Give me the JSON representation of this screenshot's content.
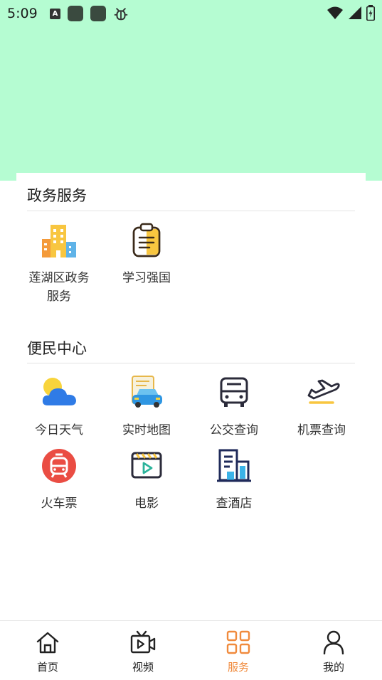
{
  "status_bar": {
    "time": "5:09",
    "a_badge": "A",
    "icons": [
      "a-badge-icon",
      "app-square-icon",
      "app-square-icon",
      "bug-icon",
      "wifi-icon",
      "signal-icon",
      "battery-icon"
    ]
  },
  "sections": [
    {
      "title": "政务服务",
      "items": [
        {
          "label": "莲湖区政务服务",
          "icon": "buildings-icon"
        },
        {
          "label": "学习强国",
          "icon": "clipboard-icon"
        }
      ]
    },
    {
      "title": "便民中心",
      "items": [
        {
          "label": "今日天气",
          "icon": "weather-icon"
        },
        {
          "label": "实时地图",
          "icon": "car-map-icon"
        },
        {
          "label": "公交查询",
          "icon": "bus-icon"
        },
        {
          "label": "机票查询",
          "icon": "airplane-icon"
        },
        {
          "label": "火车票",
          "icon": "train-icon"
        },
        {
          "label": "电影",
          "icon": "movie-icon"
        },
        {
          "label": "查酒店",
          "icon": "hotel-icon"
        }
      ]
    }
  ],
  "tabs": [
    {
      "label": "首页",
      "icon": "home-icon",
      "active": false
    },
    {
      "label": "视频",
      "icon": "video-icon",
      "active": false
    },
    {
      "label": "服务",
      "icon": "grid-icon",
      "active": true
    },
    {
      "label": "我的",
      "icon": "user-icon",
      "active": false
    }
  ],
  "colors": {
    "banner": "#b5fcd2",
    "accent": "#f08a3c",
    "text": "#222222"
  }
}
